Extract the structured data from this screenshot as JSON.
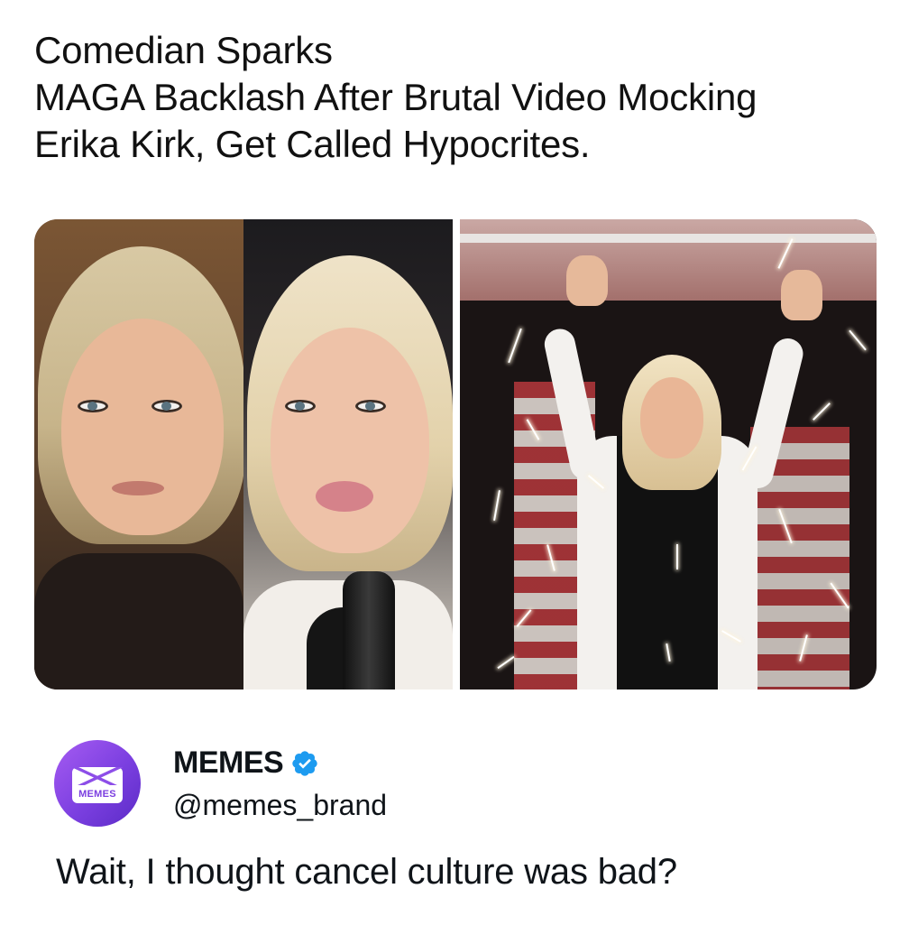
{
  "headline": {
    "line1": "Comedian Sparks",
    "line2": "MAGA Backlash After Brutal Video Mocking",
    "line3": "Erika Kirk, Get Called Hypocrites."
  },
  "tweet": {
    "author_name": "MEMES",
    "handle": "@memes_brand",
    "verified": true,
    "text": "Wait, I thought cancel culture was bad?",
    "avatar_label": "MEMES"
  },
  "colors": {
    "verified_badge": "#1d9bf0",
    "avatar_gradient_start": "#a65cf2",
    "avatar_gradient_end": "#5b2bc6",
    "text": "#0f1419"
  },
  "icons": {
    "verified": "verified-badge-icon"
  }
}
